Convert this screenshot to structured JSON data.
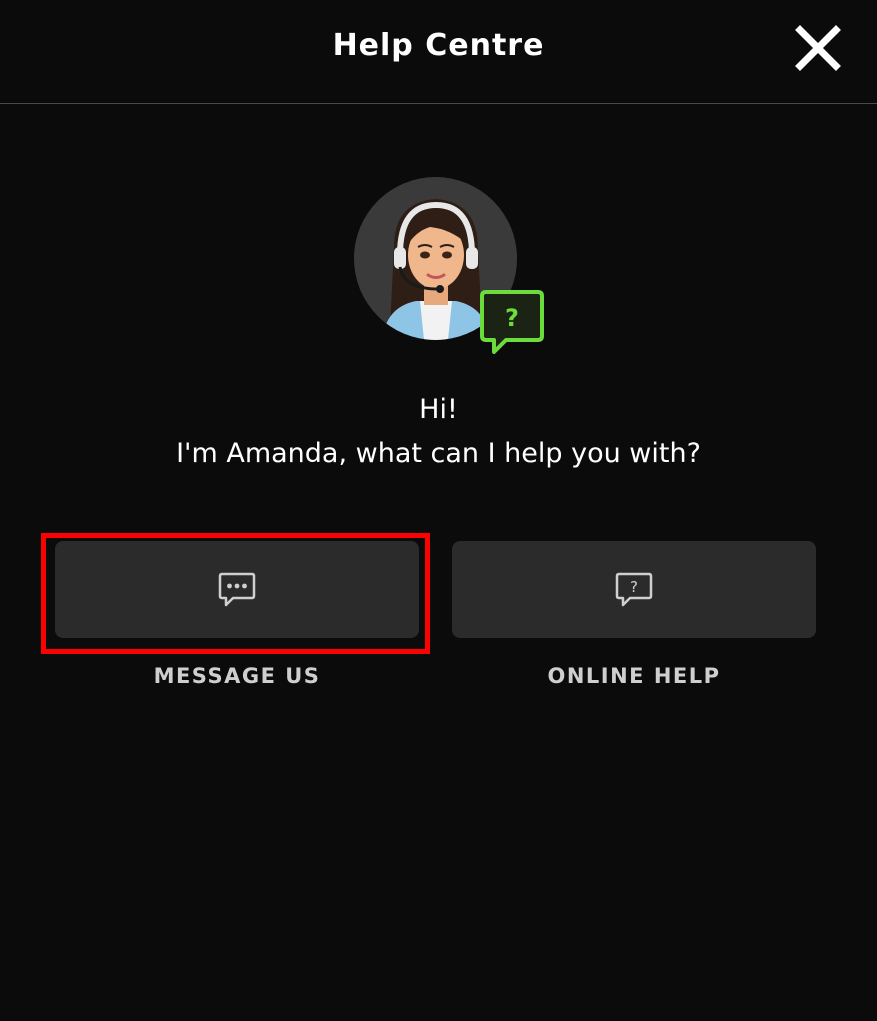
{
  "header": {
    "title": "Help Centre",
    "close_icon": "close-icon"
  },
  "agent": {
    "avatar_icon": "support-agent-avatar",
    "badge_icon": "help-chat-bubble-icon",
    "badge_glyph": "?",
    "badge_color": "#6bdc3c"
  },
  "greeting": {
    "line1": "Hi!",
    "line2": "I'm Amanda, what can I help you with?"
  },
  "options": [
    {
      "label": "MESSAGE US",
      "icon": "message-dots-icon",
      "highlighted": true
    },
    {
      "label": "ONLINE HELP",
      "icon": "question-bubble-icon",
      "highlighted": false
    }
  ],
  "colors": {
    "background": "#0b0b0b",
    "card": "#2b2b2b",
    "highlight": "#ff0000",
    "accent": "#6bdc3c"
  }
}
